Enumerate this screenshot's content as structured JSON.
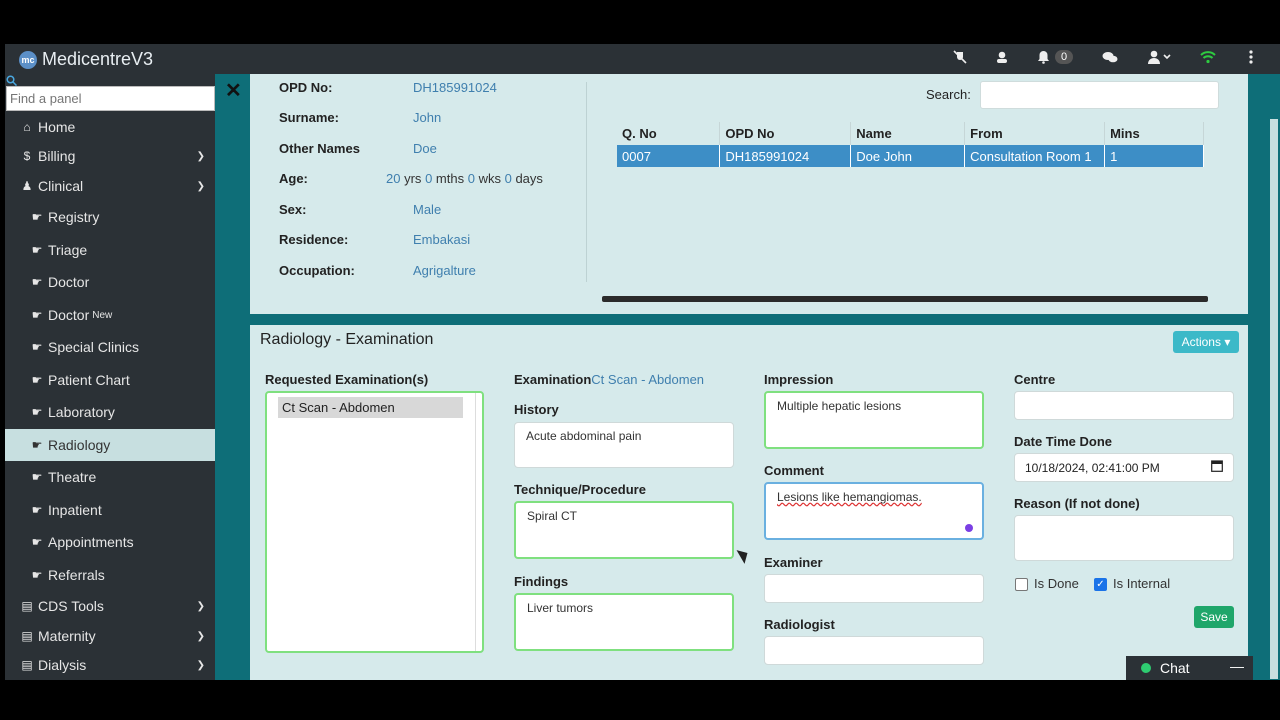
{
  "app": {
    "title": "MedicentreV3",
    "logo_text": "mc"
  },
  "topbar": {
    "notification_count": "0"
  },
  "sidebar": {
    "search_placeholder": "Find a panel",
    "items": [
      {
        "label": "Home",
        "icon": "home-icon"
      },
      {
        "label": "Billing",
        "icon": "dollar-icon"
      },
      {
        "label": "Clinical",
        "icon": "user-md-icon"
      },
      {
        "label": "Registry",
        "icon": "hand-icon"
      },
      {
        "label": "Triage",
        "icon": "hand-icon"
      },
      {
        "label": "Doctor",
        "icon": "hand-icon"
      },
      {
        "label": "Doctor",
        "icon": "hand-icon",
        "badge": "New"
      },
      {
        "label": "Special Clinics",
        "icon": "hand-icon"
      },
      {
        "label": "Patient Chart",
        "icon": "hand-icon"
      },
      {
        "label": "Laboratory",
        "icon": "hand-icon"
      },
      {
        "label": "Radiology",
        "icon": "hand-icon"
      },
      {
        "label": "Theatre",
        "icon": "hand-icon"
      },
      {
        "label": "Inpatient",
        "icon": "hand-icon"
      },
      {
        "label": "Appointments",
        "icon": "hand-icon"
      },
      {
        "label": "Referrals",
        "icon": "hand-icon"
      },
      {
        "label": "CDS Tools",
        "icon": "book-icon"
      },
      {
        "label": "Maternity",
        "icon": "book-icon"
      },
      {
        "label": "Dialysis",
        "icon": "book-icon"
      }
    ]
  },
  "patient": {
    "labels": {
      "opd": "OPD No:",
      "surname": "Surname:",
      "other": "Other Names",
      "age": "Age:",
      "sex": "Sex:",
      "residence": "Residence:",
      "occupation": "Occupation:"
    },
    "opd_no": "DH185991024",
    "surname": "John",
    "other_names": "Doe",
    "age": {
      "yrs": "20",
      "yrs_unit": "yrs",
      "mths": "0",
      "mths_unit": "mths",
      "wks": "0",
      "wks_unit": "wks",
      "days": "0",
      "days_unit": "days"
    },
    "sex": "Male",
    "residence": "Embakasi",
    "occupation": "Agrigalture"
  },
  "queue": {
    "search_label": "Search:",
    "headers": [
      "Q. No",
      "OPD No",
      "Name",
      "From",
      "Mins"
    ],
    "rows": [
      [
        "0007",
        "DH185991024",
        "Doe John",
        "Consultation Room 1",
        "1"
      ]
    ]
  },
  "radiology": {
    "title": "Radiology - Examination",
    "actions_label": "Actions",
    "requested_label": "Requested Examination(s)",
    "requested_items": [
      "Ct Scan - Abdomen"
    ],
    "examination_label": "Examination",
    "examination_value": "Ct Scan - Abdomen",
    "history_label": "History",
    "history_value": "Acute abdominal pain",
    "technique_label": "Technique/Procedure",
    "technique_value": "Spiral CT",
    "findings_label": "Findings",
    "findings_value": "Liver tumors",
    "impression_label": "Impression",
    "impression_value": "Multiple hepatic lesions",
    "comment_label": "Comment",
    "comment_value": "Lesions like hemangiomas.",
    "examiner_label": "Examiner",
    "radiologist_label": "Radiologist",
    "centre_label": "Centre",
    "datetime_label": "Date Time Done",
    "datetime_value": "10/18/2024, 02:41:00 PM",
    "reason_label": "Reason (If not done)",
    "is_done_label": "Is Done",
    "is_internal_label": "Is Internal",
    "save_label": "Save"
  },
  "chat": {
    "label": "Chat",
    "minimize": "—"
  }
}
